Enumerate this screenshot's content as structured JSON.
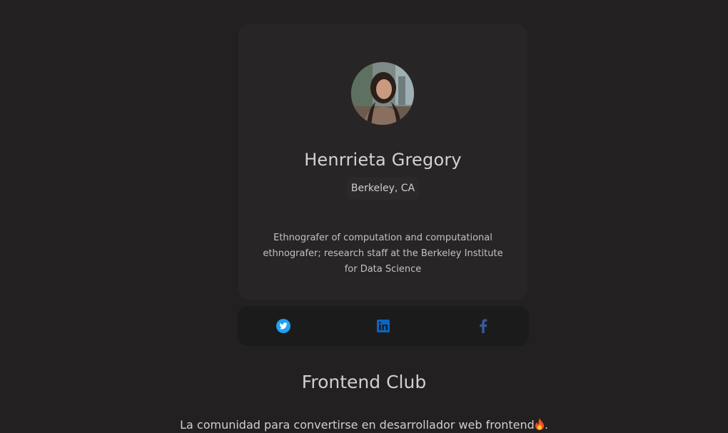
{
  "profile": {
    "name": "Henrrieta Gregory",
    "location": "Berkeley, CA",
    "bio": "Ethnografer of computation and computational ethnografer; research staff at the Berkeley Institute for Data Science"
  },
  "social": {
    "icons": [
      "twitter-icon",
      "linkedin-icon",
      "facebook-icon"
    ],
    "colors": {
      "twitter": "#1da1f2",
      "linkedin": "#0a66c2",
      "facebook": "#3b5998"
    }
  },
  "footer": {
    "title": "Frontend Club",
    "tagline": "La comunidad para convertirse en desarrollador web frontend",
    "tagline_end": "."
  },
  "colors": {
    "background": "#222021",
    "card": "#272526",
    "social_bar": "#1c1b1c"
  }
}
